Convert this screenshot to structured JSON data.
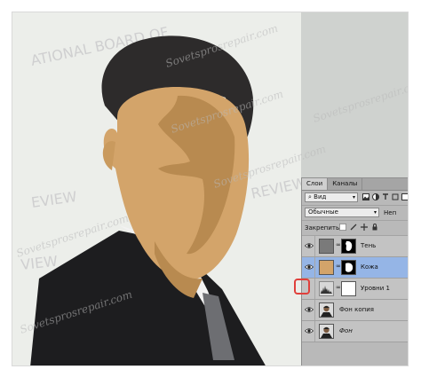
{
  "panel": {
    "tabs": [
      "Слои",
      "Каналы"
    ],
    "filter_label": "Вид",
    "blend_mode": "Обычные",
    "opacity_label": "Неп",
    "lock_label": "Закрепить:"
  },
  "layers": [
    {
      "name": "Тень",
      "visible": true,
      "selected": false
    },
    {
      "name": "Кожа",
      "visible": true,
      "selected": true
    },
    {
      "name": "Уровни 1",
      "visible": false,
      "selected": false
    },
    {
      "name": "Фон копия",
      "visible": true,
      "selected": false
    },
    {
      "name": "Фон",
      "visible": true,
      "selected": false
    }
  ],
  "watermark": "Sovetsprosrepair.com",
  "background_text": [
    "ATIONAL BOARD OF",
    "EVIEW",
    "REVIEW",
    "VIEW"
  ],
  "colors": {
    "skin": "#d3a46a",
    "skin_shade": "#b88a50",
    "hair": "#2d2b2b",
    "suit": "#1d1d1f",
    "selection": "#95b5e6",
    "highlight": "#e0403c"
  }
}
